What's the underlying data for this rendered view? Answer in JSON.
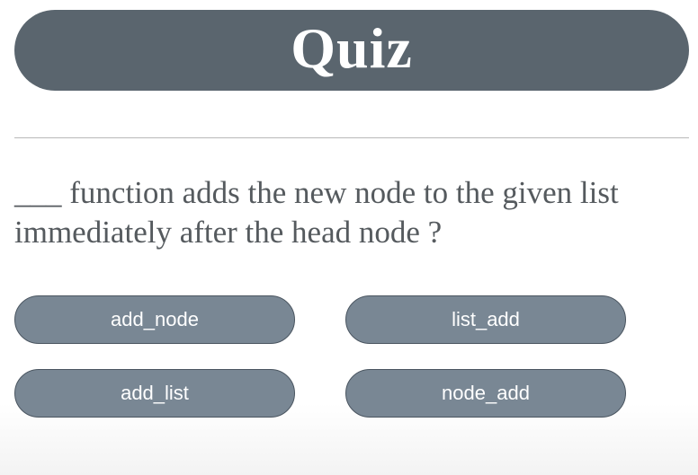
{
  "header": {
    "title": "Quiz"
  },
  "question": {
    "text": "___ function adds the new node to the given list immediately after the head node ?"
  },
  "options": [
    {
      "label": "add_node"
    },
    {
      "label": "list_add"
    },
    {
      "label": "add_list"
    },
    {
      "label": "node_add"
    }
  ],
  "colors": {
    "title_bar": "#5a656e",
    "option_button": "#798794",
    "question_text": "#555a5e"
  }
}
